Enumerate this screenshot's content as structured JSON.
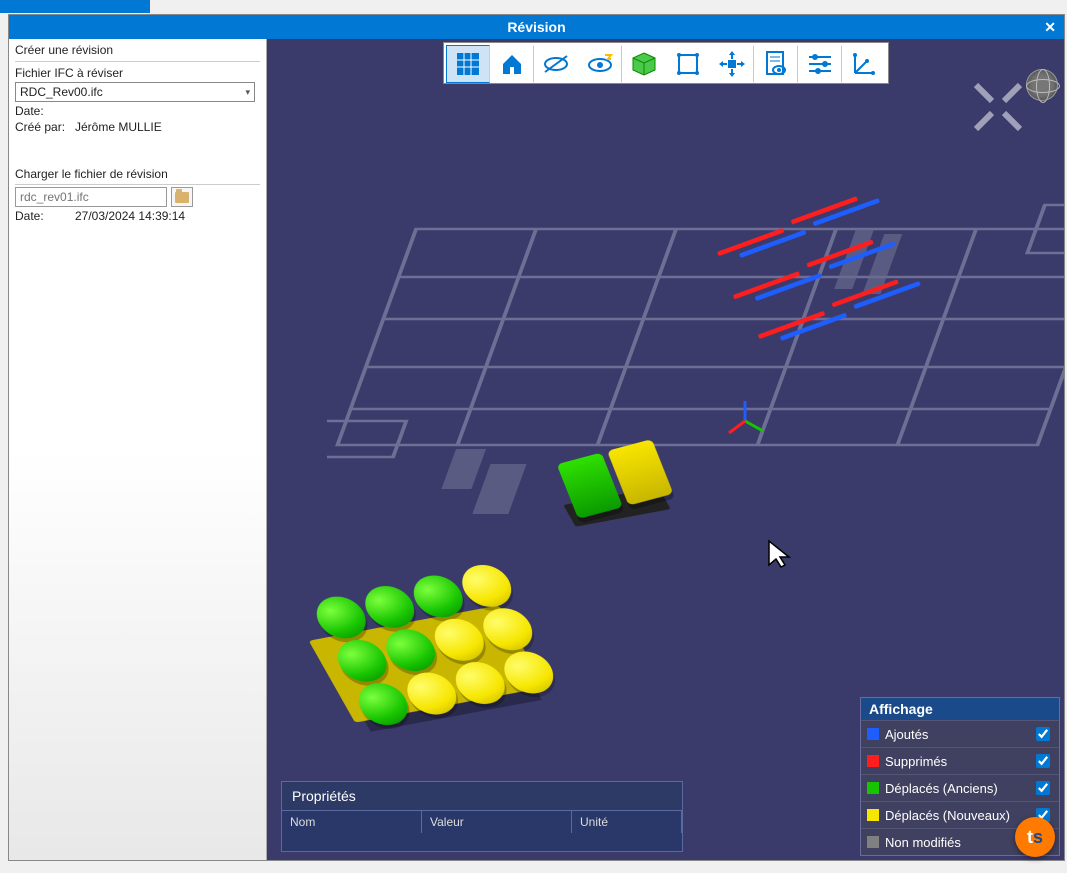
{
  "window": {
    "title": "Révision"
  },
  "sidebar": {
    "create_title": "Créer une révision",
    "ifc_label": "Fichier IFC à réviser",
    "ifc_selected": "RDC_Rev00.ifc",
    "date_label": "Date:",
    "date_value": "",
    "created_by_label": "Créé par:",
    "created_by_value": "Jérôme MULLIE",
    "load_title": "Charger le fichier de révision",
    "load_file_placeholder": "rdc_rev01.ifc",
    "load_date_label": "Date:",
    "load_date_value": "27/03/2024 14:39:14"
  },
  "toolbar": {
    "items": [
      "grid",
      "home",
      "hide",
      "unhide",
      "cube",
      "bounds",
      "move",
      "sheet",
      "sliders",
      "axes"
    ]
  },
  "properties": {
    "title": "Propriétés",
    "col_name": "Nom",
    "col_value": "Valeur",
    "col_unit": "Unité"
  },
  "legend": {
    "title": "Affichage",
    "items": [
      {
        "label": "Ajoutés",
        "color": "#1e5eff",
        "checked": true
      },
      {
        "label": "Supprimés",
        "color": "#ff1e1e",
        "checked": true
      },
      {
        "label": "Déplacés (Anciens)",
        "color": "#17c400",
        "checked": true
      },
      {
        "label": "Déplacés (Nouveaux)",
        "color": "#f6e600",
        "checked": true
      },
      {
        "label": "Non modifiés",
        "color": "#808080",
        "checked": true
      }
    ]
  }
}
